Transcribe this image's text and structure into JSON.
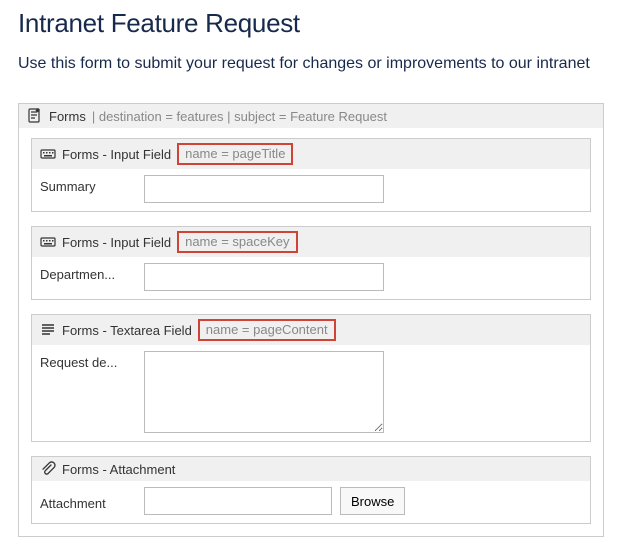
{
  "page": {
    "title": "Intranet Feature Request",
    "subtitle": "Use this form to submit your request for changes or improvements to our intranet"
  },
  "macro": {
    "title": "Forms",
    "params": "| destination = features | subject = Feature Request",
    "fields": [
      {
        "type": "input",
        "header_label": "Forms - Input Field",
        "param_text": "name = pageTitle",
        "label": "Summary",
        "value": ""
      },
      {
        "type": "input",
        "header_label": "Forms - Input Field",
        "param_text": "name = spaceKey",
        "label": "Departmen...",
        "value": ""
      },
      {
        "type": "textarea",
        "header_label": "Forms - Textarea Field",
        "param_text": "name = pageContent",
        "label": "Request de...",
        "value": ""
      },
      {
        "type": "attachment",
        "header_label": "Forms - Attachment",
        "label": "Attachment",
        "browse_label": "Browse"
      }
    ]
  }
}
